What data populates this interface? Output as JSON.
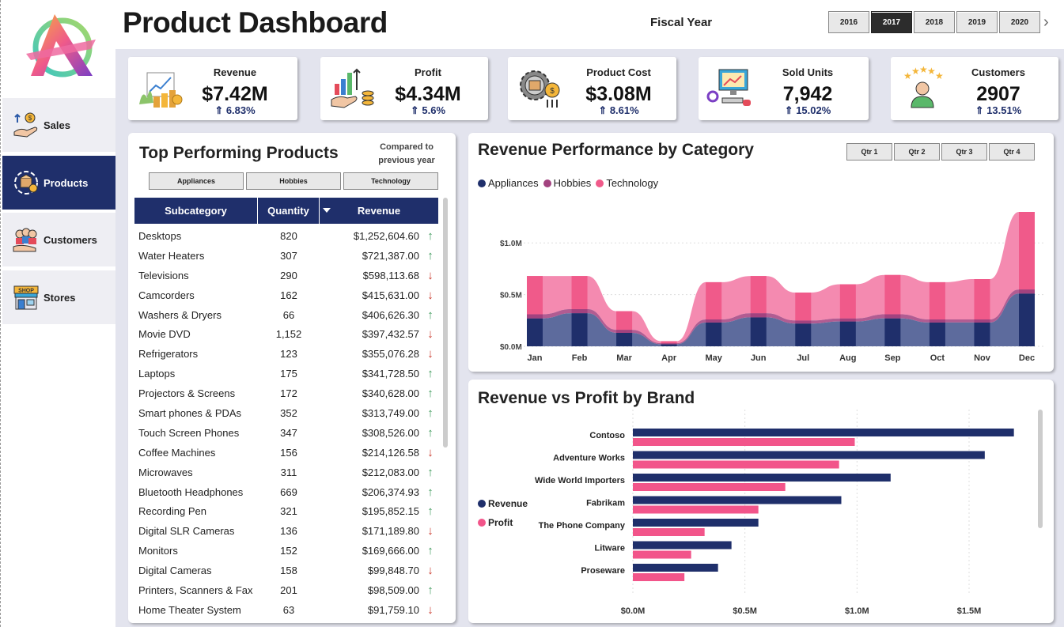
{
  "header": {
    "title": "Product Dashboard",
    "fiscal_label": "Fiscal Year"
  },
  "years": [
    "2016",
    "2017",
    "2018",
    "2019",
    "2020"
  ],
  "selected_year": "2017",
  "sidebar": {
    "items": [
      {
        "label": "Sales",
        "icon": "hand-coins-icon"
      },
      {
        "label": "Products",
        "icon": "product-box-icon"
      },
      {
        "label": "Customers",
        "icon": "people-icon"
      },
      {
        "label": "Stores",
        "icon": "shop-icon"
      }
    ],
    "active": "Products"
  },
  "kpis": [
    {
      "label": "Revenue",
      "value": "$7.42M",
      "change": "⇑ 6.83%",
      "icon": "revenue-chart-icon"
    },
    {
      "label": "Profit",
      "value": "$4.34M",
      "change": "⇑ 5.6%",
      "icon": "profit-growth-icon"
    },
    {
      "label": "Product Cost",
      "value": "$3.08M",
      "change": "⇑ 8.61%",
      "icon": "cost-gear-icon"
    },
    {
      "label": "Sold Units",
      "value": "7,942",
      "change": "⇑ 15.02%",
      "icon": "devices-icon"
    },
    {
      "label": "Customers",
      "value": "2907",
      "change": "⇑ 13.51%",
      "icon": "customers-stars-icon"
    }
  ],
  "products": {
    "title": "Top Performing Products",
    "compared": "Compared to previous year",
    "category_buttons": [
      "Appliances",
      "Hobbies",
      "Technology"
    ],
    "columns": [
      "Subcategory",
      "Quantity",
      "Revenue"
    ],
    "rows": [
      {
        "name": "Desktops",
        "qty": "820",
        "rev": "$1,252,604.60",
        "trend": "up"
      },
      {
        "name": "Water Heaters",
        "qty": "307",
        "rev": "$721,387.00",
        "trend": "up"
      },
      {
        "name": "Televisions",
        "qty": "290",
        "rev": "$598,113.68",
        "trend": "down"
      },
      {
        "name": "Camcorders",
        "qty": "162",
        "rev": "$415,631.00",
        "trend": "down"
      },
      {
        "name": "Washers & Dryers",
        "qty": "66",
        "rev": "$406,626.30",
        "trend": "up"
      },
      {
        "name": "Movie DVD",
        "qty": "1,152",
        "rev": "$397,432.57",
        "trend": "down"
      },
      {
        "name": "Refrigerators",
        "qty": "123",
        "rev": "$355,076.28",
        "trend": "down"
      },
      {
        "name": "Laptops",
        "qty": "175",
        "rev": "$341,728.50",
        "trend": "up"
      },
      {
        "name": "Projectors & Screens",
        "qty": "172",
        "rev": "$340,628.00",
        "trend": "up"
      },
      {
        "name": "Smart phones & PDAs",
        "qty": "352",
        "rev": "$313,749.00",
        "trend": "up"
      },
      {
        "name": "Touch Screen Phones",
        "qty": "347",
        "rev": "$308,526.00",
        "trend": "up"
      },
      {
        "name": "Coffee Machines",
        "qty": "156",
        "rev": "$214,126.58",
        "trend": "down"
      },
      {
        "name": "Microwaves",
        "qty": "311",
        "rev": "$212,083.00",
        "trend": "up"
      },
      {
        "name": "Bluetooth Headphones",
        "qty": "669",
        "rev": "$206,374.93",
        "trend": "up"
      },
      {
        "name": "Recording Pen",
        "qty": "321",
        "rev": "$195,852.15",
        "trend": "up"
      },
      {
        "name": "Digital SLR Cameras",
        "qty": "136",
        "rev": "$171,189.80",
        "trend": "down"
      },
      {
        "name": "Monitors",
        "qty": "152",
        "rev": "$169,666.00",
        "trend": "up"
      },
      {
        "name": "Digital Cameras",
        "qty": "158",
        "rev": "$99,848.70",
        "trend": "down"
      },
      {
        "name": "Printers, Scanners & Fax",
        "qty": "201",
        "rev": "$98,509.00",
        "trend": "up"
      },
      {
        "name": "Home Theater System",
        "qty": "63",
        "rev": "$91,759.10",
        "trend": "down"
      }
    ]
  },
  "category_chart": {
    "title": "Revenue Performance by Category",
    "quarter_buttons": [
      "Qtr 1",
      "Qtr 2",
      "Qtr 3",
      "Qtr 4"
    ]
  },
  "brand_chart": {
    "title": "Revenue vs Profit by Brand"
  },
  "colors": {
    "appliances": "#1f2f6b",
    "hobbies": "#a2427f",
    "technology": "#f05a8a",
    "technology_light": "#f48ab0",
    "navy": "#1f2f6b",
    "pink": "#f2558a"
  },
  "chart_data": [
    {
      "type": "area",
      "title": "Revenue Performance by Category",
      "categories": [
        "Jan",
        "Feb",
        "Mar",
        "Apr",
        "May",
        "Jun",
        "Jul",
        "Aug",
        "Sep",
        "Oct",
        "Nov",
        "Dec"
      ],
      "series": [
        {
          "name": "Appliances",
          "values": [
            0.27,
            0.32,
            0.13,
            0.02,
            0.23,
            0.28,
            0.22,
            0.24,
            0.27,
            0.23,
            0.23,
            0.51
          ]
        },
        {
          "name": "Hobbies",
          "values": [
            0.04,
            0.04,
            0.03,
            0.01,
            0.03,
            0.04,
            0.03,
            0.03,
            0.04,
            0.03,
            0.03,
            0.04
          ]
        },
        {
          "name": "Technology",
          "values": [
            0.37,
            0.32,
            0.18,
            0.02,
            0.36,
            0.36,
            0.27,
            0.33,
            0.38,
            0.36,
            0.39,
            0.75
          ]
        }
      ],
      "ylim": [
        0,
        1.3
      ],
      "yticks": [
        "$0.0M",
        "$0.5M",
        "$1.0M"
      ],
      "legend": "top-left"
    },
    {
      "type": "bar",
      "title": "Revenue vs Profit by Brand",
      "categories": [
        "Contoso",
        "Adventure Works",
        "Wide World Importers",
        "Fabrikam",
        "The Phone Company",
        "Litware",
        "Proseware"
      ],
      "series": [
        {
          "name": "Revenue",
          "values": [
            1.7,
            1.57,
            1.15,
            0.93,
            0.56,
            0.44,
            0.38
          ]
        },
        {
          "name": "Profit",
          "values": [
            0.99,
            0.92,
            0.68,
            0.56,
            0.32,
            0.26,
            0.23
          ]
        }
      ],
      "xlim": [
        0,
        1.8
      ],
      "xticks": [
        "$0.0M",
        "$0.5M",
        "$1.0M",
        "$1.5M"
      ],
      "legend": "left"
    }
  ]
}
